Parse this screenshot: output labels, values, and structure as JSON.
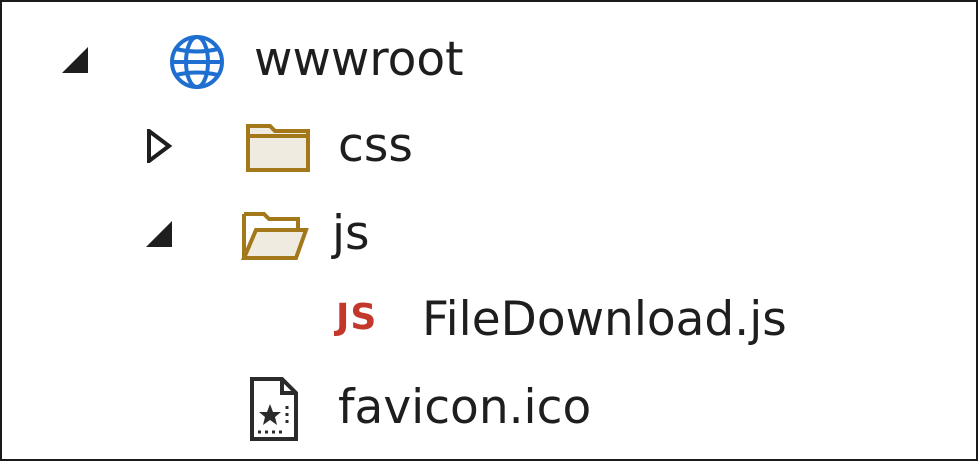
{
  "tree": {
    "items": [
      {
        "label": "wwwroot",
        "expander": "expanded",
        "icon": "globe-icon"
      },
      {
        "label": "css",
        "expander": "collapsed",
        "icon": "folder-closed-icon"
      },
      {
        "label": "js",
        "expander": "expanded",
        "icon": "folder-open-icon"
      },
      {
        "label": "FileDownload.js",
        "expander": "none",
        "icon": "js-file-icon",
        "icon_text": "JS"
      },
      {
        "label": "favicon.ico",
        "expander": "none",
        "icon": "image-file-icon"
      }
    ]
  },
  "colors": {
    "globe": "#1f6fd1",
    "folder_stroke": "#a3781b",
    "folder_fill": "#f0ebe0",
    "js_icon": "#c4372b",
    "text": "#1e1e1e",
    "expander": "#1e1e1e"
  }
}
